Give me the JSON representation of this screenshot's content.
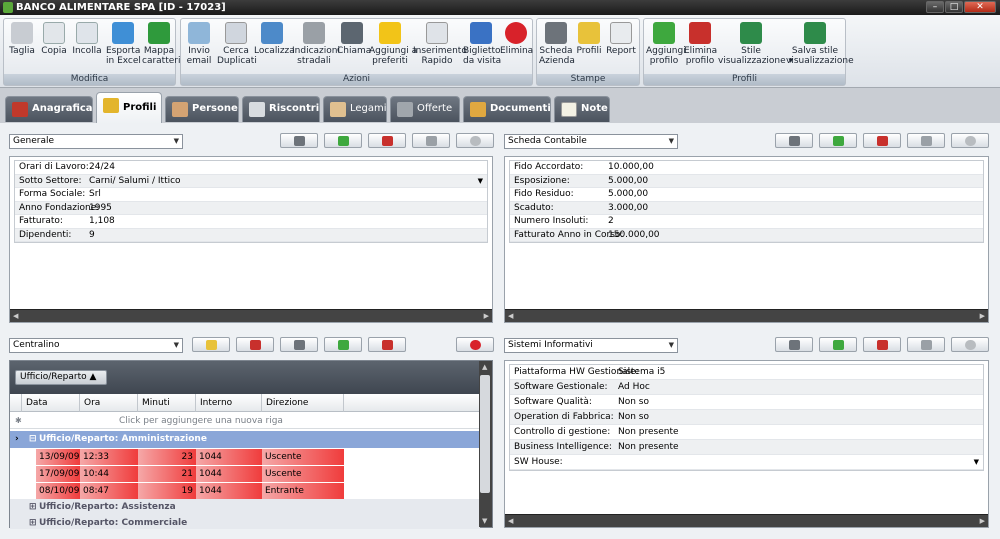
{
  "window": {
    "title": "BANCO ALIMENTARE SPA [ID - 17023]",
    "min": "–",
    "max": "□",
    "close": "✕"
  },
  "ribbon": {
    "groups": [
      {
        "caption": "Modifica",
        "buttons": [
          "Taglia",
          "Copia",
          "Incolla",
          "Esporta\nin Excel",
          "Mappa\ncaratteri"
        ]
      },
      {
        "caption": "Azioni",
        "buttons": [
          "Invio\nemail",
          "Cerca\nDuplicati",
          "Localizza",
          "Indicazioni\nstradali",
          "Chiama",
          "Aggiungi a\npreferiti",
          "Inserimento\nRapido",
          "Biglietto\nda visita",
          "Elimina"
        ]
      },
      {
        "caption": "Stampe",
        "buttons": [
          "Scheda\nAzienda",
          "Profili",
          "Report"
        ]
      },
      {
        "caption": "Profili",
        "buttons": [
          "Aggiungi\nprofilo",
          "Elimina\nprofilo",
          "Stile\nvisualizzazione ▾",
          "Salva stile\nvisualizzazione"
        ]
      }
    ]
  },
  "tabs": [
    "Anagrafica",
    "Profili",
    "Persone",
    "Riscontri",
    "Legami",
    "Offerte",
    "Documenti",
    "Note"
  ],
  "colors": {
    "tab_dark": "#5a626d",
    "highlight_blue": "#8aa6d8",
    "row_red": "#f03c3c"
  },
  "panel_generale": {
    "combo": "Generale",
    "rows": [
      {
        "k": "Orari di Lavoro:",
        "v": "24/24"
      },
      {
        "k": "Sotto Settore:",
        "v": "Carni/ Salumi / Ittico"
      },
      {
        "k": "Forma Sociale:",
        "v": "Srl"
      },
      {
        "k": "Anno Fondazione:",
        "v": "1995"
      },
      {
        "k": "Fatturato:",
        "v": "1,108"
      },
      {
        "k": "Dipendenti:",
        "v": "9"
      }
    ]
  },
  "panel_contabile": {
    "combo": "Scheda Contabile",
    "rows": [
      {
        "k": "Fido Accordato:",
        "v": "10.000,00"
      },
      {
        "k": "Esposizione:",
        "v": "5.000,00"
      },
      {
        "k": "Fido Residuo:",
        "v": "5.000,00"
      },
      {
        "k": "Scaduto:",
        "v": "3.000,00"
      },
      {
        "k": "Numero Insoluti:",
        "v": "2"
      },
      {
        "k": "Fatturato Anno in Corso:",
        "v": "150.000,00"
      }
    ]
  },
  "panel_centralino": {
    "combo": "Centralino",
    "group_chip": "Ufficio/Reparto ▲",
    "columns": [
      "Data",
      "Ora",
      "Minuti",
      "Interno",
      "Direzione"
    ],
    "new_row": "Click per aggiungere una nuova riga",
    "groups": [
      {
        "label": "Ufficio/Reparto: Amministrazione",
        "expanded": true
      },
      {
        "label": "Ufficio/Reparto: Assistenza",
        "expanded": false
      },
      {
        "label": "Ufficio/Reparto: Commerciale",
        "expanded": false
      }
    ],
    "rows": [
      [
        "13/09/09",
        "12:33",
        "23",
        "1044",
        "Uscente"
      ],
      [
        "17/09/09",
        "10:44",
        "21",
        "1044",
        "Uscente"
      ],
      [
        "08/10/09",
        "08:47",
        "19",
        "1044",
        "Entrante"
      ]
    ]
  },
  "panel_sistemi": {
    "combo": "Sistemi Informativi",
    "rows": [
      {
        "k": "Piattaforma HW Gestionale:",
        "v": "Sistema i5"
      },
      {
        "k": "Software Gestionale:",
        "v": "Ad Hoc"
      },
      {
        "k": "Software Qualità:",
        "v": "Non so"
      },
      {
        "k": "Operation di Fabbrica:",
        "v": "Non so"
      },
      {
        "k": "Controllo di gestione:",
        "v": "Non presente"
      },
      {
        "k": "Business Intelligence:",
        "v": "Non presente"
      },
      {
        "k": "SW House:",
        "v": ""
      }
    ]
  }
}
